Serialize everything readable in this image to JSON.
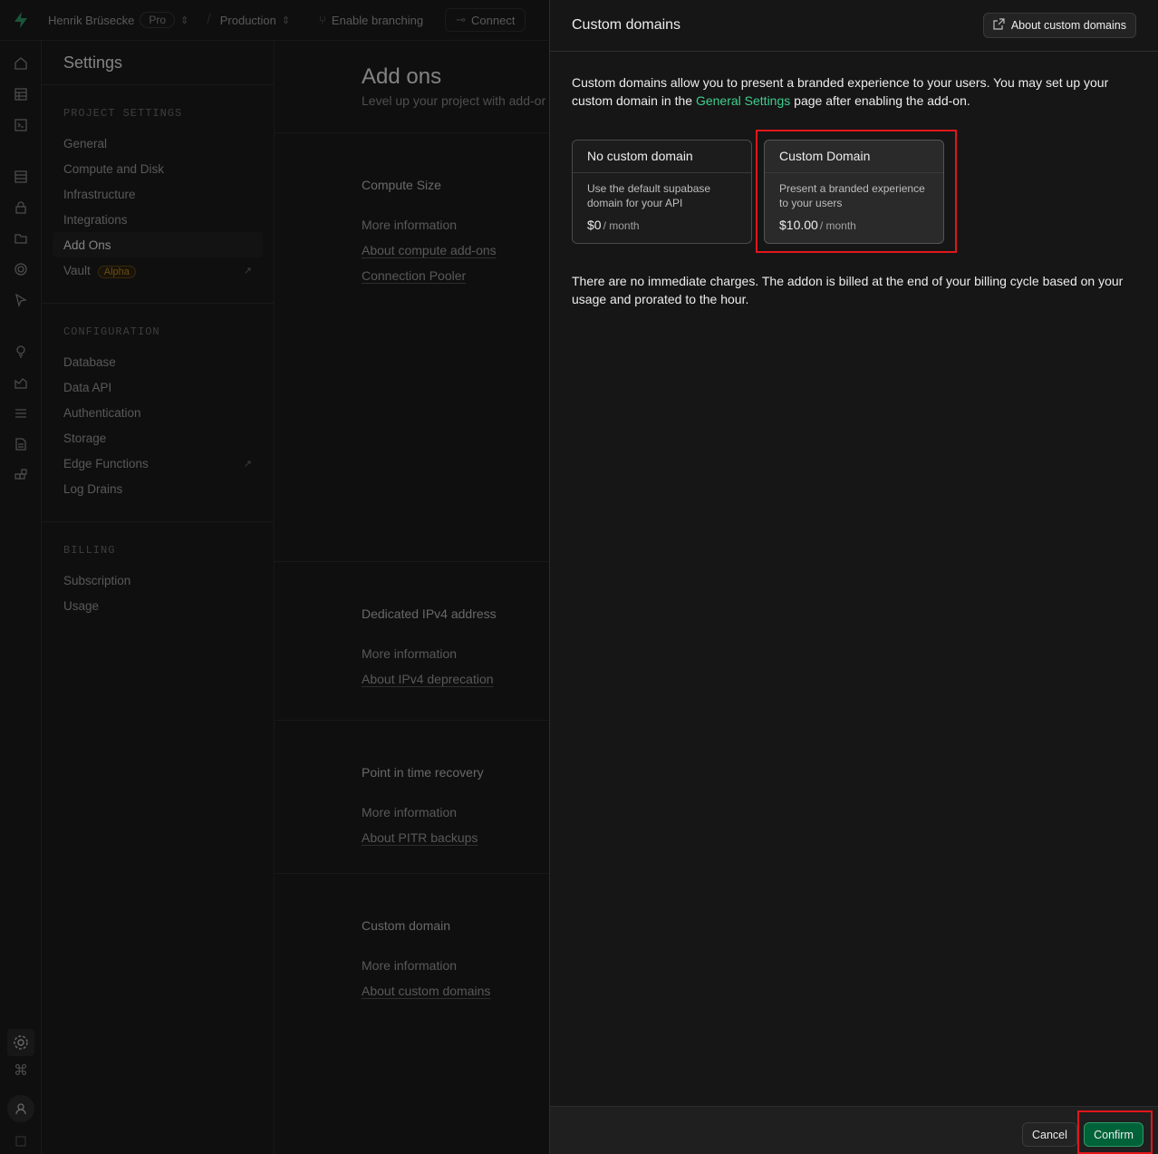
{
  "topbar": {
    "org": "Henrik Brüsecke",
    "plan": "Pro",
    "branch": "Production",
    "branching": "Enable branching",
    "connect": "Connect"
  },
  "menu": {
    "title": "Settings",
    "sections": [
      {
        "head": "PROJECT SETTINGS",
        "items": [
          "General",
          "Compute and Disk",
          "Infrastructure",
          "Integrations",
          "Add Ons",
          "Vault"
        ]
      },
      {
        "head": "CONFIGURATION",
        "items": [
          "Database",
          "Data API",
          "Authentication",
          "Storage",
          "Edge Functions",
          "Log Drains"
        ]
      },
      {
        "head": "BILLING",
        "items": [
          "Subscription",
          "Usage"
        ]
      }
    ],
    "vault_badge": "Alpha"
  },
  "content": {
    "title": "Add ons",
    "subtitle": "Level up your project with add-or",
    "sections": [
      {
        "title": "Compute Size",
        "more": "More information",
        "links": [
          "About compute add-ons",
          "Connection Pooler"
        ]
      },
      {
        "title": "Dedicated IPv4 address",
        "more": "More information",
        "links": [
          "About IPv4 deprecation"
        ]
      },
      {
        "title": "Point in time recovery",
        "more": "More information",
        "links": [
          "About PITR backups"
        ]
      },
      {
        "title": "Custom domain",
        "more": "More information",
        "links": [
          "About custom domains"
        ]
      }
    ]
  },
  "panel": {
    "title": "Custom domains",
    "about_button": "About custom domains",
    "desc_before": "Custom domains allow you to present a branded experience to your users. You may set up your custom domain in the ",
    "desc_link": "General Settings",
    "desc_after": " page after enabling the add-on.",
    "options": [
      {
        "name": "No custom domain",
        "desc": "Use the default supabase domain for your API",
        "price": "$0",
        "period": "/ month",
        "selected": false
      },
      {
        "name": "Custom Domain",
        "desc": "Present a branded experience to your users",
        "price": "$10.00",
        "period": "/ month",
        "selected": true
      }
    ],
    "note": "There are no immediate charges. The addon is billed at the end of your billing cycle based on your usage and prorated to the hour.",
    "cancel": "Cancel",
    "confirm": "Confirm"
  },
  "colors": {
    "accent": "#3ecf8e",
    "confirm_bg": "#006239",
    "highlight": "#e2161b"
  }
}
